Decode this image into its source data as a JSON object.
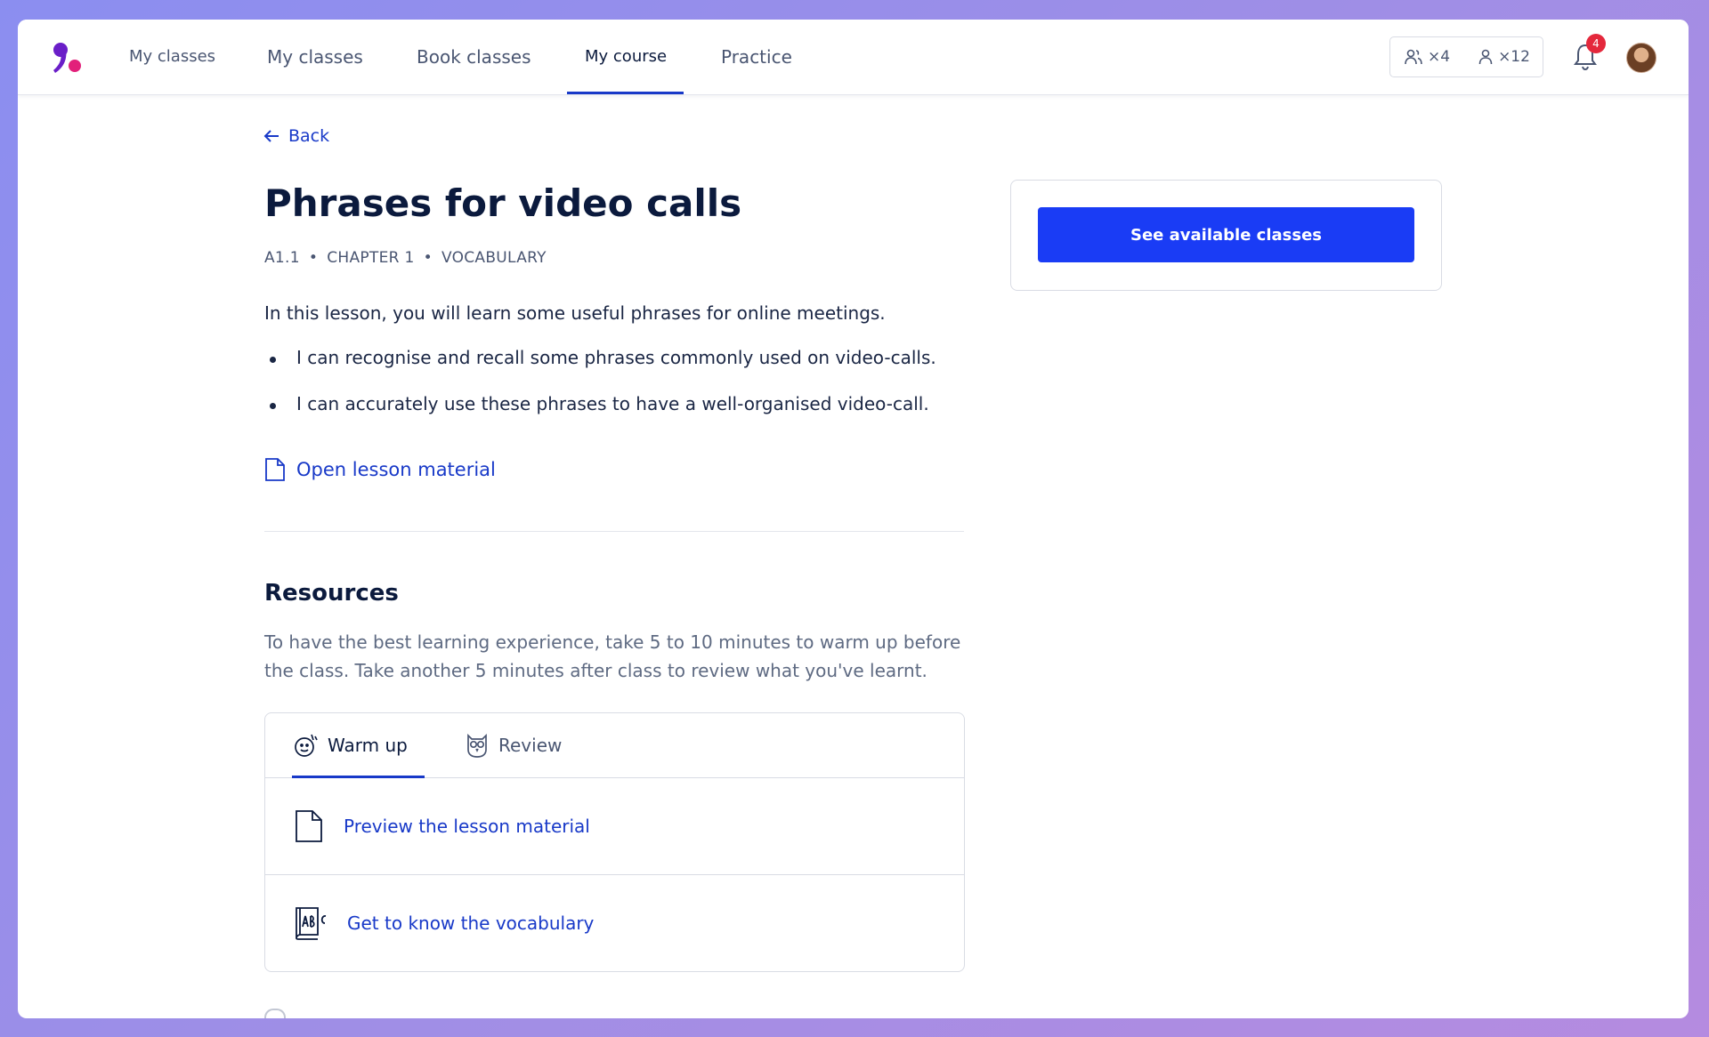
{
  "header": {
    "nav": [
      {
        "label": "My classes"
      },
      {
        "label": "My classes"
      },
      {
        "label": "Book classes"
      },
      {
        "label": "My course",
        "active": true
      },
      {
        "label": "Practice"
      }
    ],
    "credits": {
      "group": "×4",
      "private": "×12"
    },
    "notifications_count": "4"
  },
  "back_label": "Back",
  "lesson": {
    "title": "Phrases for video calls",
    "meta": {
      "level": "A1.1",
      "chapter": "CHAPTER 1",
      "type": "VOCABULARY",
      "separator": "•"
    },
    "intro": "In this lesson, you will learn some useful phrases for online meetings.",
    "objectives": [
      "I can recognise and recall some phrases commonly used on video-calls.",
      "I can accurately use these phrases to have a well-organised video-call."
    ],
    "open_material_label": "Open lesson material"
  },
  "resources": {
    "title": "Resources",
    "description": "To have the best learning experience, take 5 to 10 minutes to warm up before the class. Take another 5 minutes after class to review what you've learnt.",
    "tabs": [
      {
        "label": "Warm up",
        "icon": "warm-up-icon",
        "active": true
      },
      {
        "label": "Review",
        "icon": "owl-icon"
      }
    ],
    "items": [
      {
        "label": "Preview the lesson material",
        "icon": "document-icon"
      },
      {
        "label": "Get to know the vocabulary",
        "icon": "abc-book-icon"
      }
    ]
  },
  "side": {
    "cta_label": "See available classes"
  },
  "colors": {
    "accent": "#1839c8",
    "cta": "#1a3cf5",
    "badge": "#e4283c",
    "text": "#0b1a3d"
  }
}
